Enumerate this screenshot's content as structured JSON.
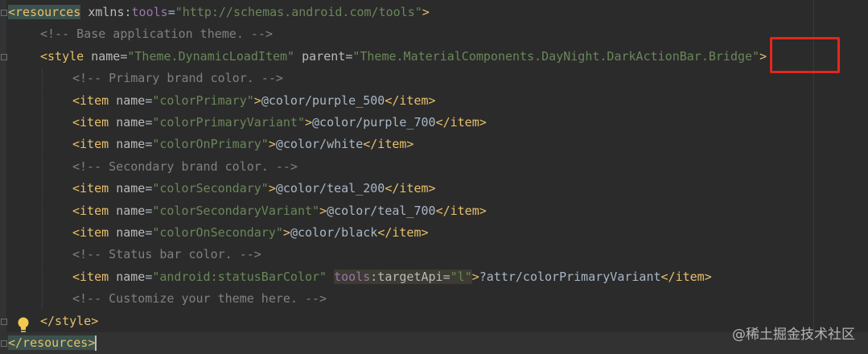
{
  "lines": [
    {
      "parts": [
        [
          "tag",
          "<resources"
        ],
        [
          "txt",
          " "
        ],
        [
          "attr",
          "xmlns"
        ],
        [
          "txt",
          ":"
        ],
        [
          "ns",
          "tools"
        ],
        [
          "txt",
          "="
        ],
        [
          "str",
          "\"http://schemas.android.com/tools\""
        ],
        [
          "tag",
          ">"
        ]
      ]
    },
    {
      "parts": [
        [
          "cmt",
          "<!-- Base application theme. -->"
        ]
      ]
    },
    {
      "parts": [
        [
          "tag",
          "<style"
        ],
        [
          "txt",
          " "
        ],
        [
          "attr",
          "name"
        ],
        [
          "txt",
          "="
        ],
        [
          "str",
          "\"Theme.DynamicLoadItem\""
        ],
        [
          "txt",
          " "
        ],
        [
          "attr",
          "parent"
        ],
        [
          "txt",
          "="
        ],
        [
          "str",
          "\"Theme.MaterialComponents.DayNight.DarkActionBar.Bridge\""
        ],
        [
          "tag",
          ">"
        ]
      ]
    },
    {
      "parts": [
        [
          "cmt",
          "<!-- Primary brand color. -->"
        ]
      ]
    },
    {
      "parts": [
        [
          "tag",
          "<item"
        ],
        [
          "txt",
          " "
        ],
        [
          "attr",
          "name"
        ],
        [
          "txt",
          "="
        ],
        [
          "str",
          "\"colorPrimary\""
        ],
        [
          "tag",
          ">"
        ],
        [
          "txt",
          "@color/purple_500"
        ],
        [
          "tag",
          "</item>"
        ]
      ]
    },
    {
      "parts": [
        [
          "tag",
          "<item"
        ],
        [
          "txt",
          " "
        ],
        [
          "attr",
          "name"
        ],
        [
          "txt",
          "="
        ],
        [
          "str",
          "\"colorPrimaryVariant\""
        ],
        [
          "tag",
          ">"
        ],
        [
          "txt",
          "@color/purple_700"
        ],
        [
          "tag",
          "</item>"
        ]
      ]
    },
    {
      "parts": [
        [
          "tag",
          "<item"
        ],
        [
          "txt",
          " "
        ],
        [
          "attr",
          "name"
        ],
        [
          "txt",
          "="
        ],
        [
          "str",
          "\"colorOnPrimary\""
        ],
        [
          "tag",
          ">"
        ],
        [
          "txt",
          "@color/white"
        ],
        [
          "tag",
          "</item>"
        ]
      ]
    },
    {
      "parts": [
        [
          "cmt",
          "<!-- Secondary brand color. -->"
        ]
      ]
    },
    {
      "parts": [
        [
          "tag",
          "<item"
        ],
        [
          "txt",
          " "
        ],
        [
          "attr",
          "name"
        ],
        [
          "txt",
          "="
        ],
        [
          "str",
          "\"colorSecondary\""
        ],
        [
          "tag",
          ">"
        ],
        [
          "txt",
          "@color/teal_200"
        ],
        [
          "tag",
          "</item>"
        ]
      ]
    },
    {
      "parts": [
        [
          "tag",
          "<item"
        ],
        [
          "txt",
          " "
        ],
        [
          "attr",
          "name"
        ],
        [
          "txt",
          "="
        ],
        [
          "str",
          "\"colorSecondaryVariant\""
        ],
        [
          "tag",
          ">"
        ],
        [
          "txt",
          "@color/teal_700"
        ],
        [
          "tag",
          "</item>"
        ]
      ]
    },
    {
      "parts": [
        [
          "tag",
          "<item"
        ],
        [
          "txt",
          " "
        ],
        [
          "attr",
          "name"
        ],
        [
          "txt",
          "="
        ],
        [
          "str",
          "\"colorOnSecondary\""
        ],
        [
          "tag",
          ">"
        ],
        [
          "txt",
          "@color/black"
        ],
        [
          "tag",
          "</item>"
        ]
      ]
    },
    {
      "parts": [
        [
          "cmt",
          "<!-- Status bar color. -->"
        ]
      ]
    },
    {
      "parts": [
        [
          "tag",
          "<item"
        ],
        [
          "txt",
          " "
        ],
        [
          "attr",
          "name"
        ],
        [
          "txt",
          "="
        ],
        [
          "str",
          "\"android:statusBarColor\""
        ],
        [
          "txt",
          " "
        ],
        [
          "ns",
          "tools"
        ],
        [
          "txt",
          ":"
        ],
        [
          "attr",
          "targetApi"
        ],
        [
          "txt",
          "="
        ],
        [
          "str",
          "\"l\""
        ],
        [
          "tag",
          ">"
        ],
        [
          "txt",
          "?attr/colorPrimaryVariant"
        ],
        [
          "tag",
          "</item>"
        ]
      ]
    },
    {
      "parts": [
        [
          "cmt",
          "<!-- Customize your theme here. -->"
        ]
      ]
    },
    {
      "parts": [
        [
          "tag",
          "</style>"
        ]
      ]
    },
    {
      "parts": [
        [
          "tag",
          "</resources>"
        ]
      ]
    }
  ],
  "watermark": "@稀土掘金技术社区",
  "colors": {
    "background": "#2b2b2b",
    "tag": "#e8bf6a",
    "string": "#6a8759",
    "comment": "#808080",
    "highlight_box": "#e5261c"
  },
  "icons": {
    "gutter_bulb": "lightbulb-icon"
  }
}
